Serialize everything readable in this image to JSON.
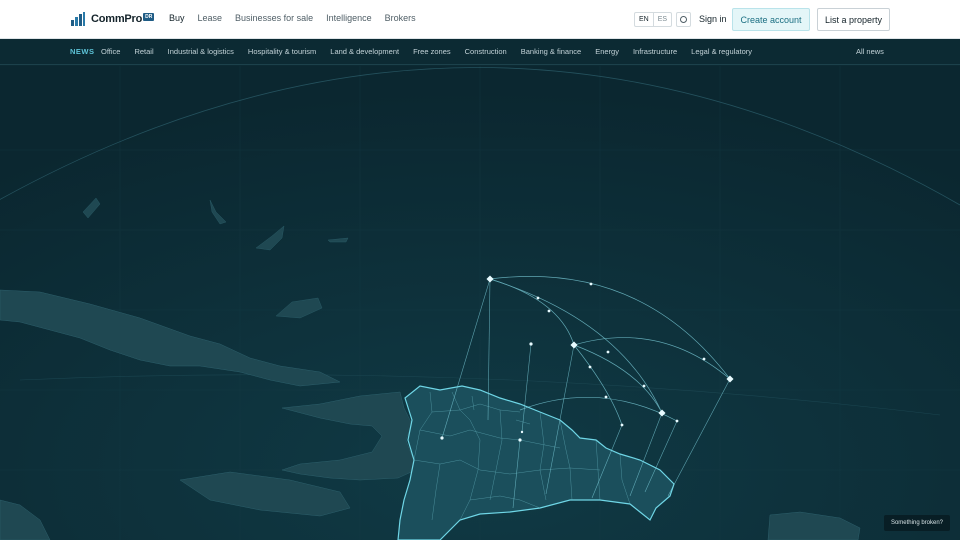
{
  "header": {
    "brand": "CommPro",
    "brand_badge": "DR",
    "nav": [
      "Buy",
      "Lease",
      "Businesses for sale",
      "Intelligence",
      "Brokers"
    ],
    "languages": [
      "EN",
      "ES"
    ],
    "sign_in": "Sign in",
    "create_account": "Create account",
    "list_property": "List a property"
  },
  "news_bar": {
    "label": "NEWS",
    "categories": [
      "Office",
      "Retail",
      "Industrial & logistics",
      "Hospitality & tourism",
      "Land & development",
      "Free zones",
      "Construction",
      "Banking & finance",
      "Energy",
      "Infrastructure",
      "Legal & regulatory"
    ],
    "all_news": "All news"
  },
  "feedback": {
    "label": "Something broken?"
  },
  "colors": {
    "accent": "#5ec4d8",
    "background": "#0c2a33",
    "land": "#1f4852",
    "island": "#1b4f5c"
  }
}
